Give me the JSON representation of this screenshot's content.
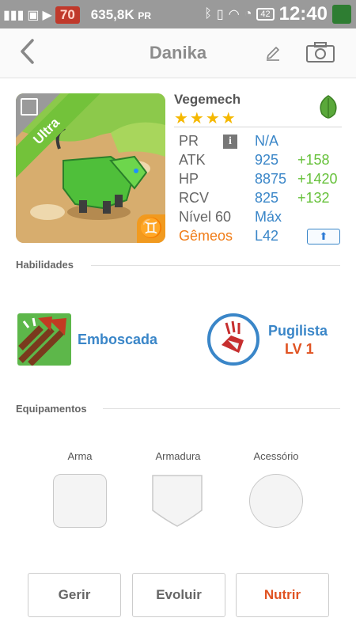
{
  "status_bar": {
    "badge": "70",
    "net_speed": "635,8K",
    "net_unit": "PR",
    "battery": "42",
    "time": "12:40"
  },
  "header": {
    "title": "Danika"
  },
  "monster": {
    "rarity": "Ultra",
    "name": "Vegemech",
    "stars": "★★★★",
    "element": "leaf-icon",
    "sign_glyph": "♊"
  },
  "stats": {
    "pr_label": "PR",
    "pr_value": "N/A",
    "atk_label": "ATK",
    "atk_value": "925",
    "atk_bonus": "+158",
    "hp_label": "HP",
    "hp_value": "8875",
    "hp_bonus": "+1420",
    "rcv_label": "RCV",
    "rcv_value": "825",
    "rcv_bonus": "+132",
    "level_label": "Nível 60",
    "level_value": "Máx",
    "sign_label": "Gêmeos",
    "sign_level": "L42"
  },
  "sections": {
    "abilities": "Habilidades",
    "equipment": "Equipamentos"
  },
  "skills": {
    "skill_name": "Emboscada",
    "ability_name": "Pugilista",
    "ability_level": "LV 1"
  },
  "equipment": {
    "weapon": "Arma",
    "armor": "Armadura",
    "accessory": "Acessório"
  },
  "actions": {
    "manage": "Gerir",
    "evolve": "Evoluir",
    "feed": "Nutrir"
  },
  "colors": {
    "accent_blue": "#3a86c8",
    "bonus_green": "#66c13a",
    "sign_orange": "#f07c17",
    "feed_red": "#e05322",
    "rarity_green": "#73c23a"
  }
}
